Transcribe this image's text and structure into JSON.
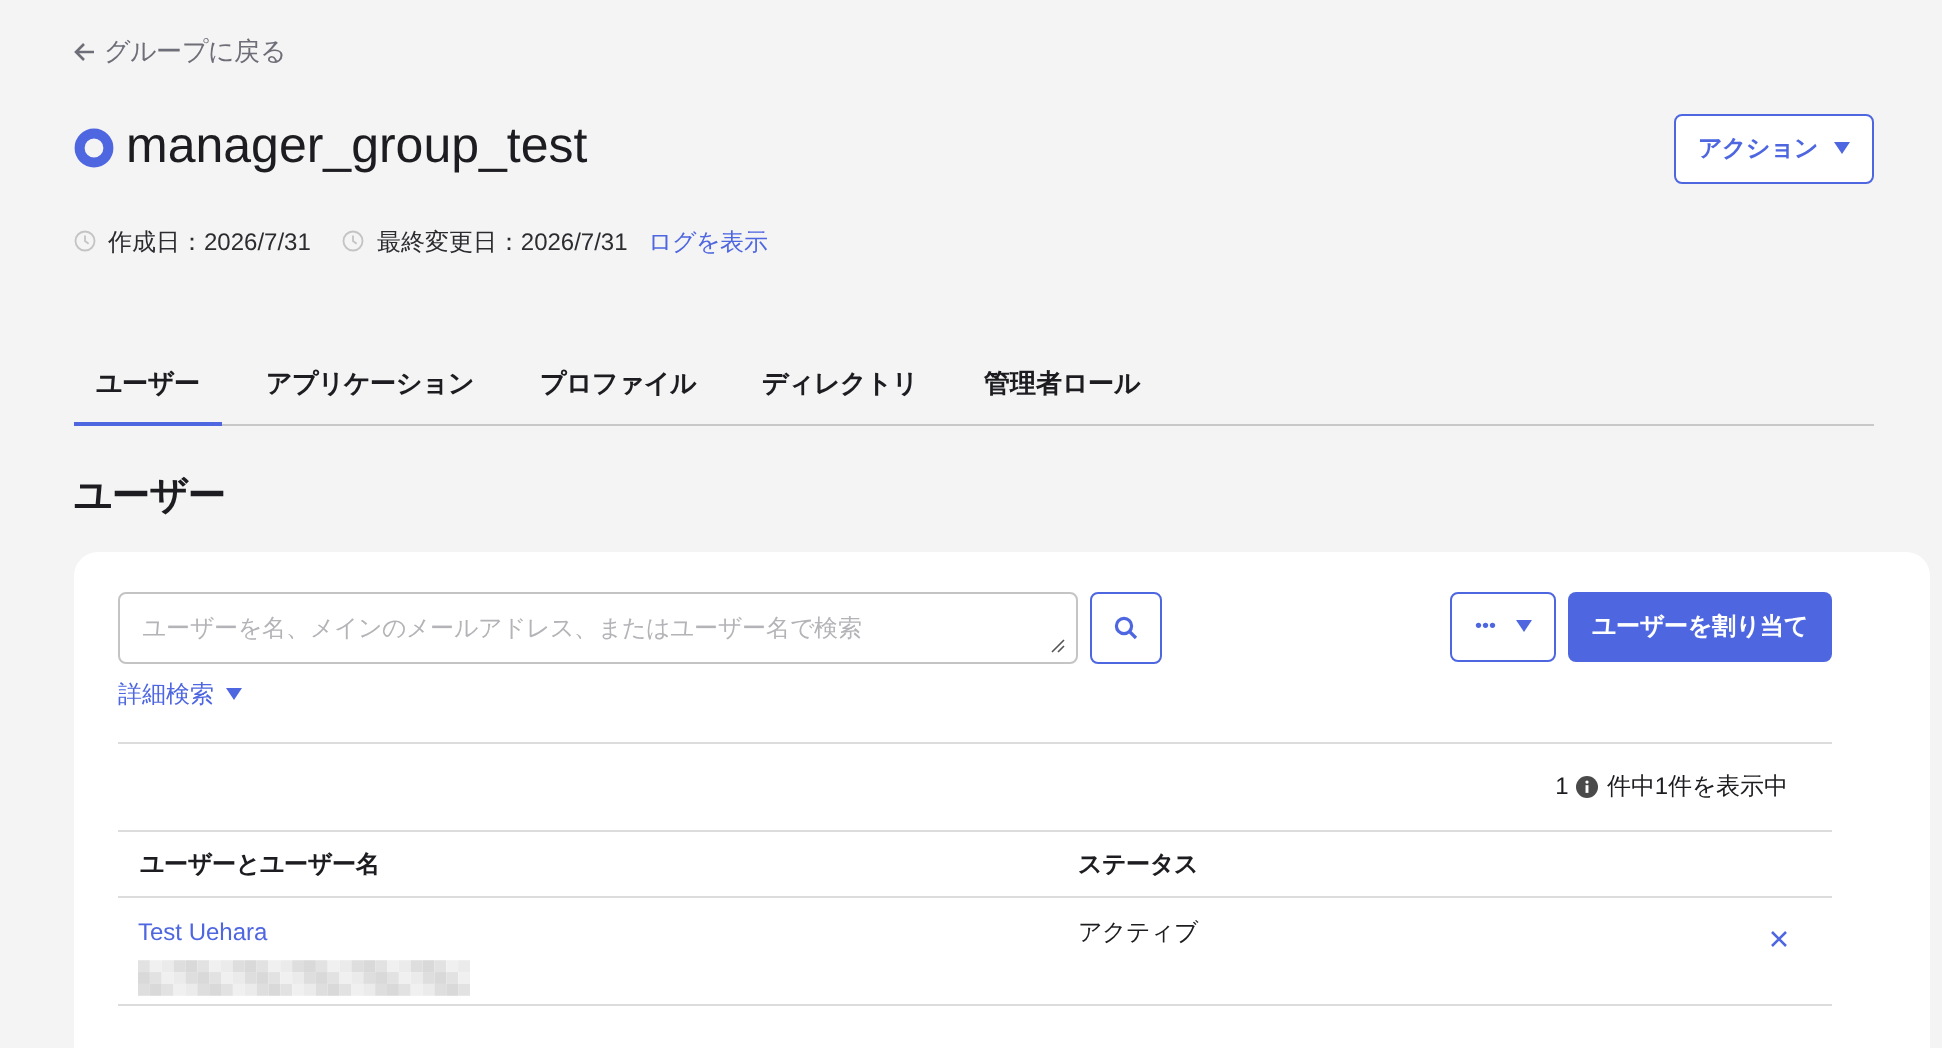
{
  "back_link": "グループに戻る",
  "title": "manager_group_test",
  "actions_button": "アクション",
  "meta": {
    "created": "作成日：2026/7/31",
    "modified": "最終変更日：2026/7/31",
    "log_link": "ログを表示"
  },
  "tabs": [
    {
      "label": "ユーザー",
      "selected": true
    },
    {
      "label": "アプリケーション",
      "selected": false
    },
    {
      "label": "プロファイル",
      "selected": false
    },
    {
      "label": "ディレクトリ",
      "selected": false
    },
    {
      "label": "管理者ロール",
      "selected": false
    }
  ],
  "section_title": "ユーザー",
  "search": {
    "placeholder": "ユーザーを名、メインのメールアドレス、またはユーザー名で検索"
  },
  "advanced_search": "詳細検索",
  "more_button": "•••",
  "assign_button": "ユーザーを割り当て",
  "count": {
    "number": "1",
    "text": "件中1件を表示中"
  },
  "table": {
    "columns": [
      "ユーザーとユーザー名",
      "ステータス"
    ],
    "rows": [
      {
        "name": "Test Uehara",
        "status": "アクティブ"
      }
    ]
  }
}
